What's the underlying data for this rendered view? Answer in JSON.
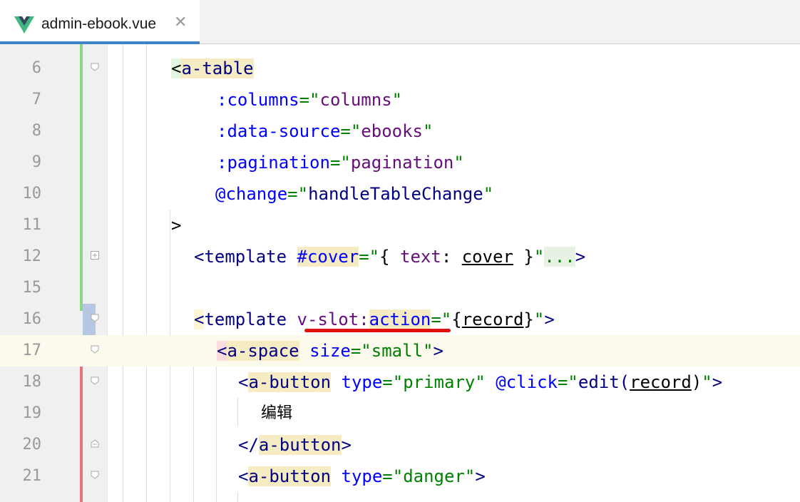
{
  "tab": {
    "title": "admin-ebook.vue",
    "close": "✕",
    "icon": "vue-logo-icon"
  },
  "colors": {
    "accent": "#4083c9",
    "vue_green": "#41b883",
    "vue_dark": "#35495e",
    "vcs_added": "#8bd884",
    "vcs_modified": "#b5c7e3",
    "vcs_error": "#e6747e",
    "tag": "#000080",
    "attribute": "#0000ff",
    "string": "#008000",
    "expression": "#660e7a",
    "squiggle": "#e0100e"
  },
  "lines": [
    {
      "num": "6"
    },
    {
      "num": "7"
    },
    {
      "num": "8"
    },
    {
      "num": "9"
    },
    {
      "num": "10"
    },
    {
      "num": "11"
    },
    {
      "num": "12"
    },
    {
      "num": "15"
    },
    {
      "num": "16"
    },
    {
      "num": "17"
    },
    {
      "num": "18"
    },
    {
      "num": "19"
    },
    {
      "num": "20"
    },
    {
      "num": "21"
    }
  ],
  "code": {
    "l6": {
      "lt": "<",
      "tag": "a-table"
    },
    "l7": {
      "attr": ":columns",
      "eq": "=\"",
      "val": "columns",
      "q": "\""
    },
    "l8": {
      "attr": ":data-source",
      "eq": "=\"",
      "val": "ebooks",
      "q": "\""
    },
    "l9": {
      "attr": ":pagination",
      "eq": "=\"",
      "val": "pagination",
      "q": "\""
    },
    "l10": {
      "attr": "@change",
      "eq": "=\"",
      "val": "handleTableChange",
      "q": "\""
    },
    "l11": {
      "gt": ">"
    },
    "l12": {
      "lt": "<",
      "tag": "template",
      "sp": " ",
      "attr": "#cover",
      "eq": "=\"",
      "open": "{ ",
      "key": "text",
      "colon": ": ",
      "ident": "cover",
      "close": " }",
      "q": "\"",
      "dots": "...",
      "gt": ">"
    },
    "l16": {
      "lt": "<",
      "tag": "template",
      "sp": " ",
      "dir": "v-slot:",
      "arg": "action",
      "eq": "=\"",
      "open": "{",
      "ident": "record",
      "close": "}",
      "q": "\"",
      "gt": ">"
    },
    "l17": {
      "lt": "<",
      "tag": "a-space",
      "sp": " ",
      "attr": "size",
      "eq": "=\"",
      "val": "small",
      "q": "\"",
      "gt": ">"
    },
    "l18": {
      "lt": "<",
      "tag": "a-button",
      "sp": " ",
      "attr": "type",
      "eq": "=\"",
      "val": "primary",
      "q": "\"",
      "sp2": " ",
      "attr2": "@click",
      "eq2": "=\"",
      "fn": "edit(",
      "ident": "record",
      "fnclose": ")",
      "q2": "\"",
      "gt": ">"
    },
    "l19": {
      "text": "编辑"
    },
    "l20": {
      "lt": "</",
      "tag": "a-button",
      "gt": ">"
    },
    "l21": {
      "lt": "<",
      "tag": "a-button",
      "sp": " ",
      "attr": "type",
      "eq": "=\"",
      "val": "danger",
      "q": "\"",
      "gt": ">"
    }
  }
}
